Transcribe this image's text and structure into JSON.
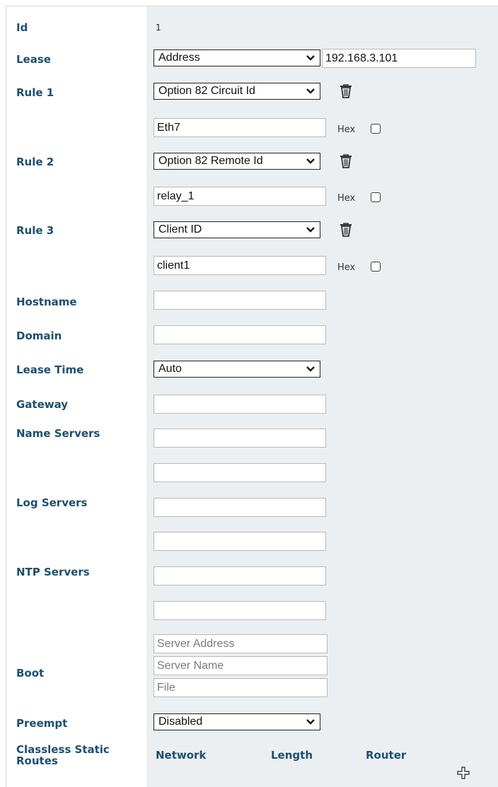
{
  "fields": {
    "id": {
      "label": "Id",
      "value": "1"
    },
    "lease": {
      "label": "Lease",
      "type": "Address",
      "address": "192.168.3.101"
    },
    "rules": [
      {
        "label": "Rule 1",
        "type": "Option 82 Circuit Id",
        "value": "Eth7",
        "hex_label": "Hex",
        "hex_checked": false
      },
      {
        "label": "Rule 2",
        "type": "Option 82 Remote Id",
        "value": "relay_1",
        "hex_label": "Hex",
        "hex_checked": false
      },
      {
        "label": "Rule 3",
        "type": "Client ID",
        "value": "client1",
        "hex_label": "Hex",
        "hex_checked": false
      }
    ],
    "hostname": {
      "label": "Hostname",
      "value": ""
    },
    "domain": {
      "label": "Domain",
      "value": ""
    },
    "lease_time": {
      "label": "Lease Time",
      "value": "Auto"
    },
    "gateway": {
      "label": "Gateway",
      "value": ""
    },
    "name_servers": {
      "label": "Name Servers",
      "values": [
        "",
        ""
      ]
    },
    "log_servers": {
      "label": "Log Servers",
      "values": [
        "",
        ""
      ]
    },
    "ntp_servers": {
      "label": "NTP Servers",
      "values": [
        "",
        ""
      ]
    },
    "boot": {
      "label": "Boot",
      "server_address_placeholder": "Server Address",
      "server_name_placeholder": "Server Name",
      "file_placeholder": "File"
    },
    "preempt": {
      "label": "Preempt",
      "value": "Disabled"
    },
    "routes": {
      "label_line1": "Classless Static",
      "label_line2": "Routes",
      "columns": [
        "Network",
        "Length",
        "Router"
      ]
    }
  },
  "icons": {
    "delete": "trash-icon",
    "dropdown": "chevron-down-icon",
    "add": "plus-icon"
  },
  "colors": {
    "label": "#1d4f6e",
    "panel": "#eceff1"
  }
}
